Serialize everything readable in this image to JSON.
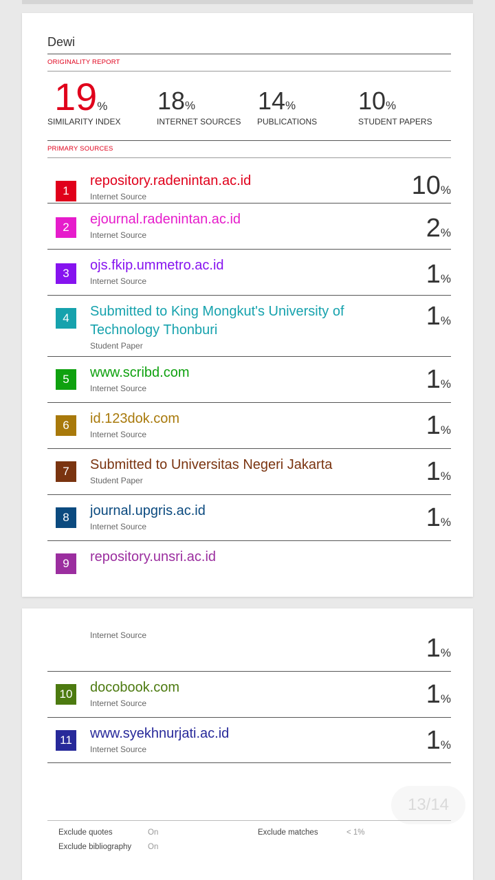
{
  "report": {
    "title": "Dewi",
    "originality_label": "ORIGINALITY REPORT",
    "primary_sources_label": "PRIMARY SOURCES",
    "similarity": {
      "value": "19",
      "pct": "%",
      "label": "SIMILARITY INDEX"
    },
    "internet": {
      "value": "18",
      "pct": "%",
      "label": "INTERNET SOURCES"
    },
    "publications": {
      "value": "14",
      "pct": "%",
      "label": "PUBLICATIONS"
    },
    "student": {
      "value": "10",
      "pct": "%",
      "label": "STUDENT PAPERS"
    }
  },
  "sources": [
    {
      "index": "1",
      "name": "repository.radenintan.ac.id",
      "type": "Internet Source",
      "value": "10",
      "pct": "%",
      "color": "#e0001b"
    },
    {
      "index": "2",
      "name": "ejournal.radenintan.ac.id",
      "type": "Internet Source",
      "value": "2",
      "pct": "%",
      "color": "#e61ccb"
    },
    {
      "index": "3",
      "name": "ojs.fkip.ummetro.ac.id",
      "type": "Internet Source",
      "value": "1",
      "pct": "%",
      "color": "#8613ef"
    },
    {
      "index": "4",
      "name": "Submitted to King Mongkut's University of Technology Thonburi",
      "type": "Student Paper",
      "value": "1",
      "pct": "%",
      "color": "#16a2ad"
    },
    {
      "index": "5",
      "name": "www.scribd.com",
      "type": "Internet Source",
      "value": "1",
      "pct": "%",
      "color": "#0fa10f"
    },
    {
      "index": "6",
      "name": "id.123dok.com",
      "type": "Internet Source",
      "value": "1",
      "pct": "%",
      "color": "#a8790b"
    },
    {
      "index": "7",
      "name": "Submitted to Universitas Negeri Jakarta",
      "type": "Student Paper",
      "value": "1",
      "pct": "%",
      "color": "#7a3410"
    },
    {
      "index": "8",
      "name": "journal.upgris.ac.id",
      "type": "Internet Source",
      "value": "1",
      "pct": "%",
      "color": "#0b4a7f"
    },
    {
      "index": "9",
      "name": "repository.unsri.ac.id",
      "type": "Internet Source",
      "value": "1",
      "pct": "%",
      "color": "#9b2e9f"
    },
    {
      "index": "10",
      "name": "docobook.com",
      "type": "Internet Source",
      "value": "1",
      "pct": "%",
      "color": "#4c7a10"
    },
    {
      "index": "11",
      "name": "www.syekhnurjati.ac.id",
      "type": "Internet Source",
      "value": "1",
      "pct": "%",
      "color": "#27299a"
    }
  ],
  "pager": {
    "text": "13/14"
  },
  "footer": {
    "exclude_quotes_label": "Exclude quotes",
    "exclude_quotes_value": "On",
    "exclude_bibliography_label": "Exclude bibliography",
    "exclude_bibliography_value": "On",
    "exclude_matches_label": "Exclude matches",
    "exclude_matches_value": "< 1%"
  }
}
